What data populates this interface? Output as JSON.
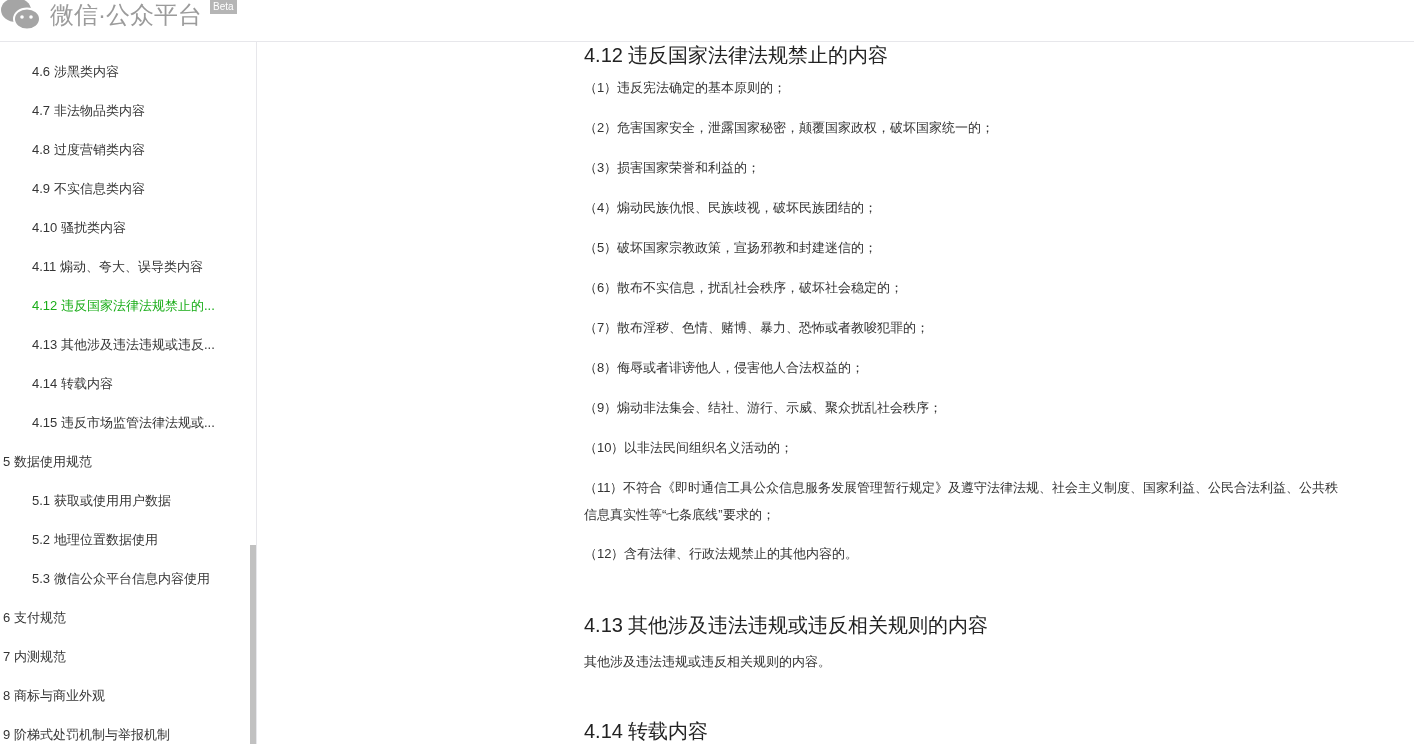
{
  "header": {
    "logo_text": "微信·公众平台",
    "badge": "Beta"
  },
  "toc": [
    {
      "children": [
        {
          "label": "4.6 涉黑类内容",
          "selected": false
        },
        {
          "label": "4.7 非法物品类内容",
          "selected": false
        },
        {
          "label": "4.8 过度营销类内容",
          "selected": false
        },
        {
          "label": "4.9 不实信息类内容",
          "selected": false
        },
        {
          "label": "4.10 骚扰类内容",
          "selected": false
        },
        {
          "label": "4.11 煽动、夸大、误导类内容",
          "selected": false
        },
        {
          "label": "4.12 违反国家法律法规禁止的...",
          "selected": true
        },
        {
          "label": "4.13 其他涉及违法违规或违反...",
          "selected": false
        },
        {
          "label": "4.14 转载内容",
          "selected": false
        },
        {
          "label": "4.15 违反市场监管法律法规或...",
          "selected": false
        }
      ]
    },
    {
      "label": "5 数据使用规范",
      "selected": false,
      "children": [
        {
          "label": "5.1 获取或使用用户数据",
          "selected": false
        },
        {
          "label": "5.2 地理位置数据使用",
          "selected": false
        },
        {
          "label": "5.3 微信公众平台信息内容使用",
          "selected": false
        }
      ]
    },
    {
      "label": "6 支付规范",
      "selected": false
    },
    {
      "label": "7 内测规范",
      "selected": false
    },
    {
      "label": "8 商标与商业外观",
      "selected": false
    },
    {
      "label": "9 阶梯式处罚机制与举报机制",
      "selected": false
    }
  ],
  "sections": [
    {
      "heading": "4.12 违反国家法律法规禁止的内容",
      "paragraphs": [
        {
          "lines": [
            "（1）违反宪法确定的基本原则的；"
          ]
        },
        {
          "lines": [
            "（2）危害国家安全，泄露国家秘密，颠覆国家政权，破坏国家统一的；"
          ]
        },
        {
          "lines": [
            "（3）损害国家荣誉和利益的；"
          ]
        },
        {
          "lines": [
            "（4）煽动民族仇恨、民族歧视，破坏民族团结的；"
          ]
        },
        {
          "lines": [
            "（5）破坏国家宗教政策，宣扬邪教和封建迷信的；"
          ]
        },
        {
          "lines": [
            "（6）散布不实信息，扰乱社会秩序，破坏社会稳定的；"
          ]
        },
        {
          "lines": [
            "（7）散布淫秽、色情、赌博、暴力、恐怖或者教唆犯罪的；"
          ]
        },
        {
          "lines": [
            "（8）侮辱或者诽谤他人，侵害他人合法权益的；"
          ]
        },
        {
          "lines": [
            "（9）煽动非法集会、结社、游行、示威、聚众扰乱社会秩序；"
          ]
        },
        {
          "lines": [
            "（10）以非法民间组织名义活动的；"
          ]
        },
        {
          "lines": [
            "（11）不符合《即时通信工具公众信息服务发展管理暂行规定》及遵守法律法规、社会主义制度、国家利益、公民合法利益、公共秩",
            "信息真实性等“七条底线”要求的；"
          ]
        },
        {
          "lines": [
            "（12）含有法律、行政法规禁止的其他内容的。"
          ]
        }
      ]
    },
    {
      "heading": "4.13 其他涉及违法违规或违反相关规则的内容",
      "paragraphs": [
        {
          "lines": [
            "其他涉及违法违规或违反相关规则的内容。"
          ]
        }
      ]
    },
    {
      "heading": "4.14 转载内容"
    }
  ]
}
